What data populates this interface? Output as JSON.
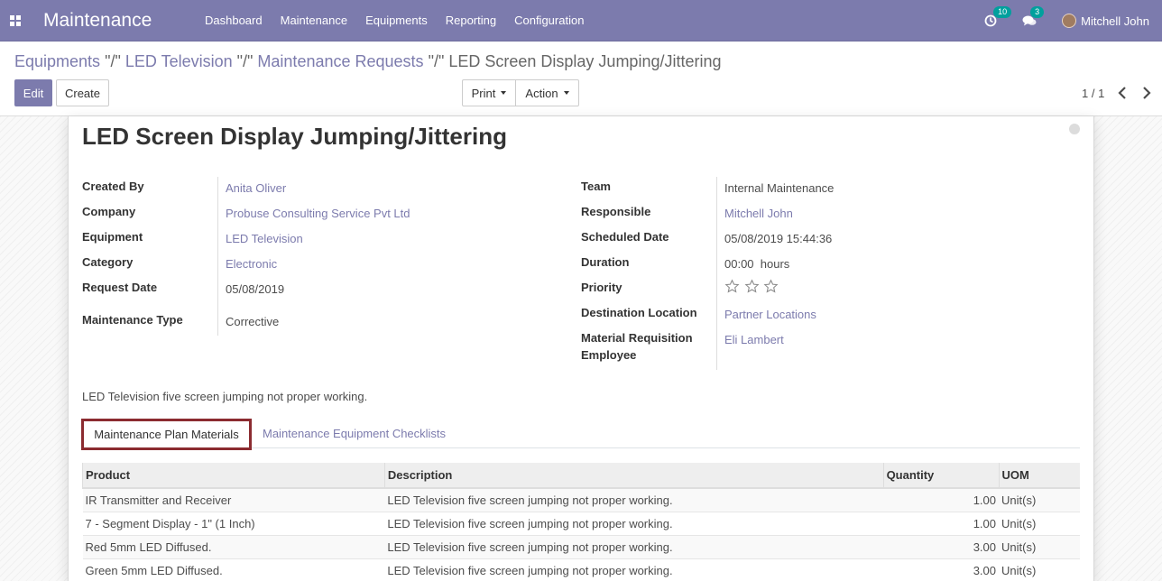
{
  "navbar": {
    "app_title": "Maintenance",
    "menu": [
      "Dashboard",
      "Maintenance",
      "Equipments",
      "Reporting",
      "Configuration"
    ],
    "activity_count": "10",
    "messages_count": "3",
    "user_name": "Mitchell John"
  },
  "breadcrumb": {
    "items": [
      "Equipments",
      "LED Television",
      "Maintenance Requests"
    ],
    "separator": "\"/\"",
    "current": "LED Screen Display Jumping/Jittering"
  },
  "buttons": {
    "edit": "Edit",
    "create": "Create",
    "print": "Print",
    "action": "Action"
  },
  "pager": "1 / 1",
  "record": {
    "title": "LED Screen Display Jumping/Jittering",
    "left_fields": [
      {
        "label": "Created By",
        "value": "Anita Oliver"
      },
      {
        "label": "Company",
        "value": "Probuse Consulting Service Pvt Ltd"
      },
      {
        "label": "Equipment",
        "value": "LED Television"
      },
      {
        "label": "Category",
        "value": "Electronic"
      },
      {
        "label": "Request Date",
        "value": "05/08/2019"
      },
      {
        "label": "Maintenance Type",
        "value": "Corrective"
      }
    ],
    "right_fields": [
      {
        "label": "Team",
        "value": "Internal Maintenance"
      },
      {
        "label": "Responsible",
        "value": "Mitchell John"
      },
      {
        "label": "Scheduled Date",
        "value": "05/08/2019 15:44:36"
      },
      {
        "label": "Duration",
        "value": "00:00  hours"
      },
      {
        "label": "Priority",
        "value": 0
      },
      {
        "label": "Destination Location",
        "value": "Partner Locations"
      },
      {
        "label": "Material Requisition",
        "label2": "Employee",
        "value": "Eli Lambert"
      }
    ],
    "priority_max": 3,
    "description": "LED Television five screen jumping not proper working."
  },
  "tabs": [
    "Maintenance Plan Materials",
    "Maintenance Equipment Checklists"
  ],
  "table": {
    "headers": [
      "Product",
      "Description",
      "Quantity",
      "UOM"
    ],
    "rows": [
      [
        "IR Transmitter and Receiver",
        "LED Television five screen jumping not proper working.",
        "1.00",
        "Unit(s)"
      ],
      [
        "7 - Segment Display - 1\" (1 Inch)",
        "LED Television five screen jumping not proper working.",
        "1.00",
        "Unit(s)"
      ],
      [
        "Red 5mm LED Diffused.",
        "LED Television five screen jumping not proper working.",
        "3.00",
        "Unit(s)"
      ],
      [
        "Green 5mm LED Diffused.",
        "LED Television five screen jumping not proper working.",
        "3.00",
        "Unit(s)"
      ]
    ]
  }
}
